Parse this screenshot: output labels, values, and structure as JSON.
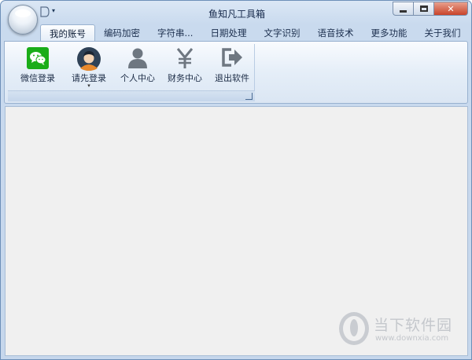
{
  "window": {
    "title": "鱼知凡工具箱",
    "close_label": "✕"
  },
  "tabs": [
    {
      "label": "我的账号",
      "active": true
    },
    {
      "label": "编码加密"
    },
    {
      "label": "字符串..."
    },
    {
      "label": "日期处理"
    },
    {
      "label": "文字识别"
    },
    {
      "label": "语音技术"
    },
    {
      "label": "更多功能"
    },
    {
      "label": "关于我们"
    }
  ],
  "ribbon": {
    "buttons": [
      {
        "label": "微信登录",
        "icon": "wechat-icon"
      },
      {
        "label": "请先登录",
        "icon": "user-avatar-icon",
        "dropdown": true
      },
      {
        "label": "个人中心",
        "icon": "person-icon"
      },
      {
        "label": "财务中心",
        "icon": "yen-icon"
      },
      {
        "label": "退出软件",
        "icon": "exit-icon"
      }
    ]
  },
  "watermark": {
    "text": "当下软件园",
    "url": "www.downxia.com"
  },
  "colors": {
    "frame": "#c6d7ec",
    "wechat_green": "#1aad19",
    "content_bg": "#f0f0f0"
  }
}
